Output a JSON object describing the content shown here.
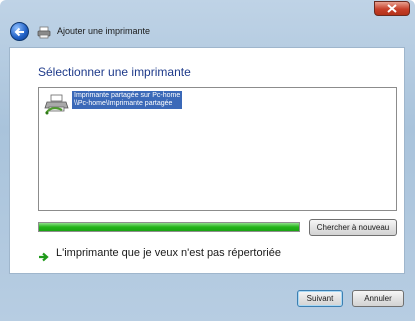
{
  "window": {
    "title": "Ajouter une imprimante",
    "colors": {
      "heading": "#1e3a8a",
      "selection": "#3b69b8",
      "progress": "#23b51a",
      "close": "#c7402a"
    }
  },
  "main": {
    "heading": "Sélectionner une imprimante",
    "printers": [
      {
        "name": "Imprimante partagée sur Pc-home",
        "path": "\\\\Pc-home\\Imprimante partagée",
        "selected": true,
        "icon": "network-printer-icon"
      }
    ],
    "progress": {
      "percent": 100
    },
    "search_again_label": "Chercher à nouveau",
    "not_listed_link": "L'imprimante que je veux n'est pas répertoriée"
  },
  "footer": {
    "next_label": "Suivant",
    "cancel_label": "Annuler"
  }
}
